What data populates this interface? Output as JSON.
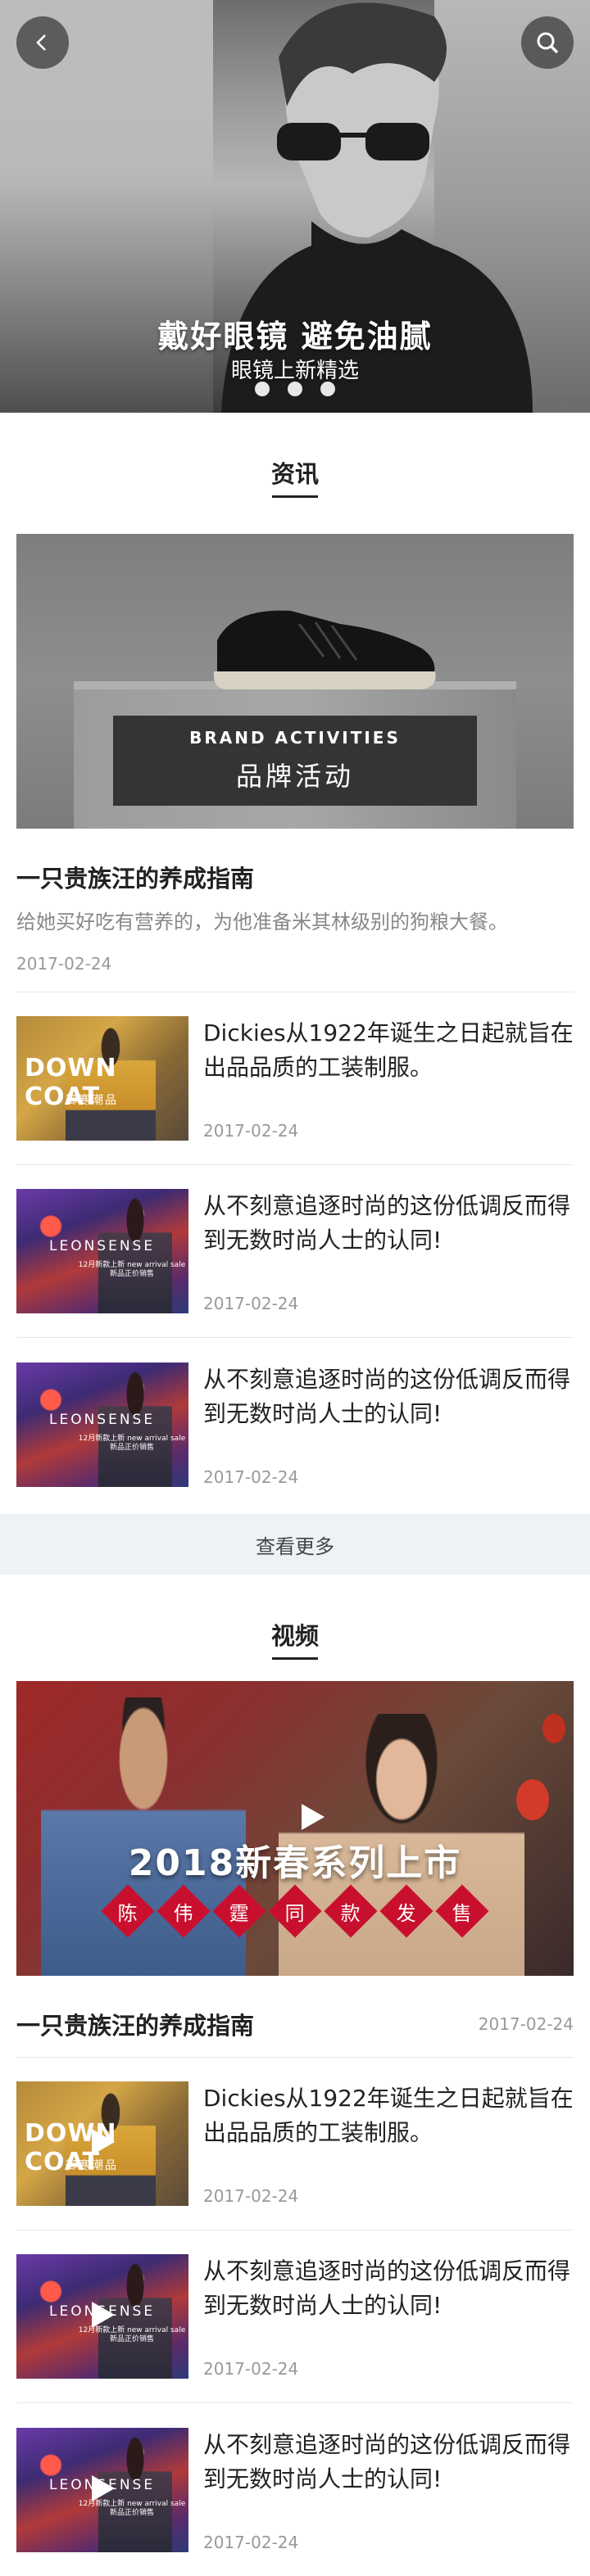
{
  "hero": {
    "title": "戴好眼镜 避免油腻",
    "subtitle": "眼镜上新精选",
    "dots": 3
  },
  "nav": {
    "back_icon": "back-icon",
    "search_icon": "search-icon"
  },
  "news": {
    "heading": "资讯",
    "banner": {
      "en": "BRAND ACTIVITIES",
      "zh": "品牌活动"
    },
    "feature": {
      "title": "一只贵族汪的养成指南",
      "desc": "给她买好吃有营养的，为他准备米其林级别的狗粮大餐。",
      "date": "2017-02-24"
    },
    "items": [
      {
        "title": "Dickies从1922年诞生之日起就旨在出品品质的工装制服。",
        "date": "2017-02-24",
        "thumb_text": "DOWN COAT",
        "thumb_sub": "御寒潮品"
      },
      {
        "title": "从不刻意追逐时尚的这份低调反而得到无数时尚人士的认同!",
        "date": "2017-02-24",
        "thumb_text": "LEONSENSE",
        "thumb_sub": "12月新款上新 new arrival sale 新品正价销售"
      },
      {
        "title": "从不刻意追逐时尚的这份低调反而得到无数时尚人士的认同!",
        "date": "2017-02-24",
        "thumb_text": "LEONSENSE",
        "thumb_sub": "12月新款上新 new arrival sale 新品正价销售"
      }
    ],
    "more": "查看更多"
  },
  "video": {
    "heading": "视频",
    "banner": {
      "headline": "2018新春系列上市",
      "tags": [
        "陈",
        "伟",
        "霆",
        "同",
        "款",
        "发",
        "售"
      ]
    },
    "feature": {
      "title": "一只贵族汪的养成指南",
      "date": "2017-02-24"
    },
    "items": [
      {
        "title": "Dickies从1922年诞生之日起就旨在出品品质的工装制服。",
        "date": "2017-02-24",
        "thumb_text": "DOWN COAT",
        "thumb_sub": "御寒潮品"
      },
      {
        "title": "从不刻意追逐时尚的这份低调反而得到无数时尚人士的认同!",
        "date": "2017-02-24",
        "thumb_text": "LEONSENSE",
        "thumb_sub": "12月新款上新 new arrival sale 新品正价销售"
      },
      {
        "title": "从不刻意追逐时尚的这份低调反而得到无数时尚人士的认同!",
        "date": "2017-02-24",
        "thumb_text": "LEONSENSE",
        "thumb_sub": "12月新款上新 new arrival sale 新品正价销售"
      }
    ]
  },
  "colors": {
    "accent_red": "#c8102e",
    "more_bg": "#eef1f5",
    "divider": "#e8e8e8"
  }
}
